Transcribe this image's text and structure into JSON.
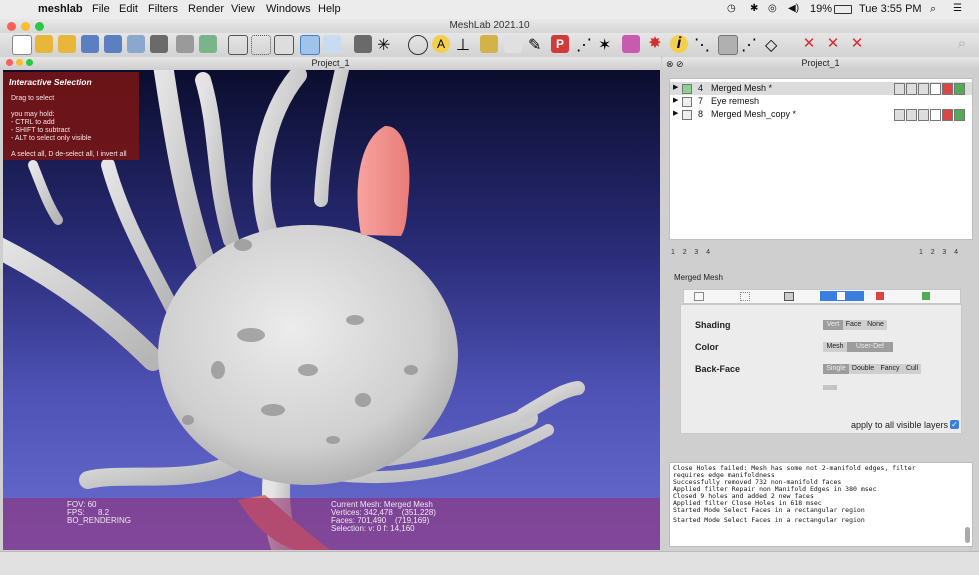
{
  "menubar": {
    "app": "meshlab",
    "menus": [
      "File",
      "Edit",
      "Filters",
      "Render",
      "View",
      "Windows",
      "Help"
    ],
    "battery": "19%",
    "clock": "Tue 3:55 PM"
  },
  "window": {
    "title": "MeshLab 2021.10"
  },
  "viewport": {
    "title": "Project_1",
    "selection_panel": {
      "heading": "Interactive Selection",
      "lines": [
        "Drag to select",
        "",
        "you may hold:",
        "- CTRL to add",
        "- SHIFT to subtract",
        "- ALT to select only visible",
        "",
        "A select all, D de-select all, I invert all"
      ]
    },
    "info": {
      "fov": "FOV: 60",
      "fps_label": "FPS:",
      "fps_value": "8.2",
      "rendering": "BO_RENDERING",
      "current_mesh": "Current Mesh: Merged Mesh",
      "vertices": "Vertices: 342,478    (351,228)",
      "faces": "Faces: 701,490    (719,169)",
      "selection": "Selection: v: 0 f: 14,160"
    }
  },
  "right_panel": {
    "title": "Project_1",
    "layers": [
      {
        "id": "4",
        "name": "Merged Mesh *"
      },
      {
        "id": "7",
        "name": "Eye remesh"
      },
      {
        "id": "8",
        "name": "Merged Mesh_copy *"
      }
    ],
    "pager_left": [
      "1",
      "2",
      "3",
      "4"
    ],
    "pager_right": [
      "1",
      "2",
      "3",
      "4"
    ],
    "props": {
      "mesh_name": "Merged Mesh",
      "shading": {
        "label": "Shading",
        "options": [
          "Vert",
          "Face",
          "None"
        ],
        "selected": "Vert"
      },
      "color": {
        "label": "Color",
        "options": [
          "Mesh",
          "User-Def"
        ],
        "selected": "User-Def"
      },
      "backface": {
        "label": "Back-Face",
        "options": [
          "Single",
          "Double",
          "Fancy",
          "Cull"
        ],
        "selected": "Single"
      },
      "apply_all_label": "apply to all visible layers"
    },
    "log": [
      "Close Holes failed: Mesh has some not 2-manifold edges, filter",
      "requires edge manifoldness",
      "Successfully removed 732 non-manifold faces",
      "Applied filter Repair non Manifold Edges in 380 msec",
      "Closed 9 holes and added 2 new faces",
      "Applied filter Close Holes in 618 msec",
      "Started Mode Select Faces in a rectangular region",
      "",
      "Started Mode Select Faces in a rectangular region"
    ]
  },
  "colors": {
    "selection_panel_bg": "#781414",
    "info_bar_bg": "#962870",
    "mesh_gray": "#d7d7d7",
    "selected_red": "#f08a86",
    "viewport_top": "#0b0d2e",
    "viewport_bottom": "#6a6ed0"
  }
}
